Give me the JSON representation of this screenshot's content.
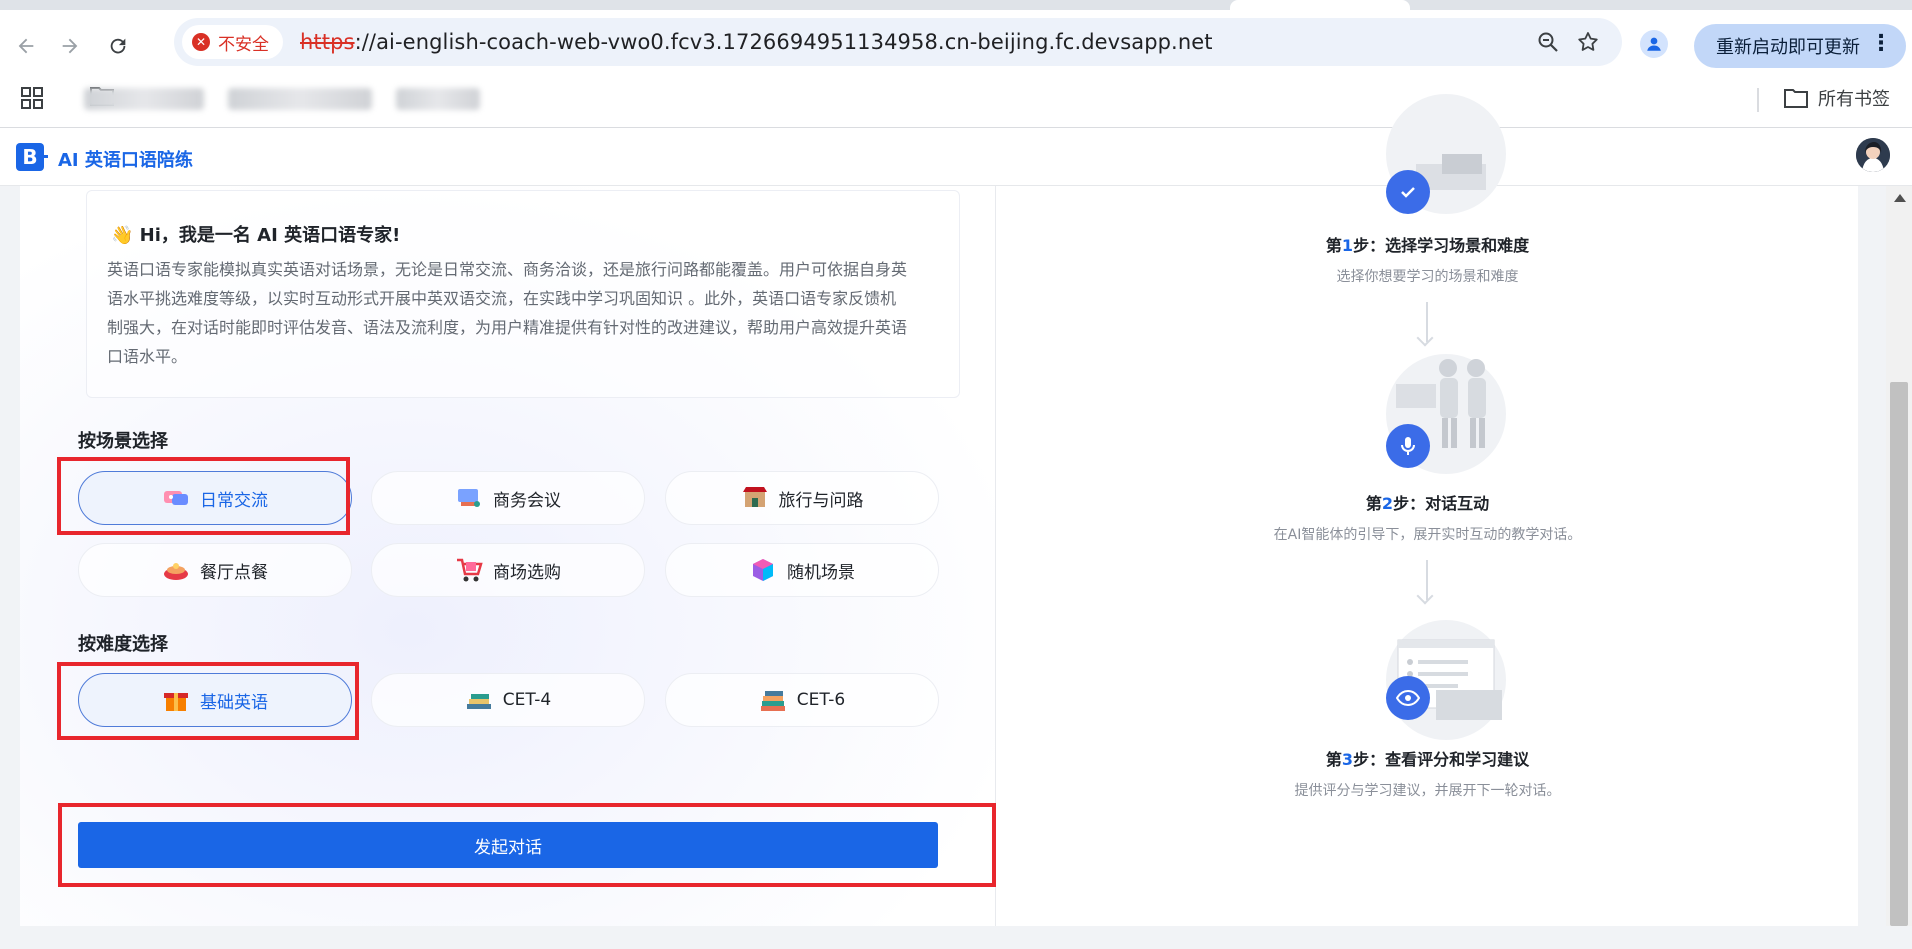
{
  "browser": {
    "security_label": "不安全",
    "url_scheme": "https",
    "url_rest": "://ai-english-coach-web-vwo0.fcv3.1726694951134958.cn-beijing.fc.devsapp.net",
    "update_button": "重新启动即可更新",
    "menu_dots": "⋮",
    "all_bookmarks": "所有书签"
  },
  "site": {
    "logo_letter": "B",
    "title": "AI 英语口语陪练"
  },
  "intro": {
    "title": "👋 Hi，我是一名 AI 英语口语专家!",
    "body": "英语口语专家能模拟真实英语对话场景，无论是日常交流、商务洽谈，还是旅行问路都能覆盖。用户可依据自身英语水平挑选难度等级，以实时互动形式开展中英双语交流，在实践中学习巩固知识 。此外，英语口语专家反馈机制强大，在对话时能即时评估发音、语法及流利度，为用户精准提供有针对性的改进建议，帮助用户高效提升英语口语水平。"
  },
  "scene_section": {
    "label": "按场景选择",
    "options": [
      {
        "label": "日常交流",
        "icon": "daily-chat-icon",
        "selected": true
      },
      {
        "label": "商务会议",
        "icon": "business-meeting-icon",
        "selected": false
      },
      {
        "label": "旅行与问路",
        "icon": "travel-icon",
        "selected": false
      },
      {
        "label": "餐厅点餐",
        "icon": "restaurant-icon",
        "selected": false
      },
      {
        "label": "商场选购",
        "icon": "shopping-cart-icon",
        "selected": false
      },
      {
        "label": "随机场景",
        "icon": "random-dice-icon",
        "selected": false
      }
    ]
  },
  "difficulty_section": {
    "label": "按难度选择",
    "options": [
      {
        "label": "基础英语",
        "icon": "gift-box-icon",
        "selected": true
      },
      {
        "label": "CET-4",
        "icon": "books-icon",
        "selected": false
      },
      {
        "label": "CET-6",
        "icon": "book-stack-icon",
        "selected": false
      }
    ]
  },
  "start_button": "发起对话",
  "steps": [
    {
      "prefix": "第",
      "num": "1",
      "suffix": "步：选择学习场景和难度",
      "desc": "选择你想要学习的场景和难度"
    },
    {
      "prefix": "第",
      "num": "2",
      "suffix": "步：对话互动",
      "desc": "在AI智能体的引导下，展开实时互动的教学对话。"
    },
    {
      "prefix": "第",
      "num": "3",
      "suffix": "步：查看评分和学习建议",
      "desc": "提供评分与学习建议，并展开下一轮对话。"
    }
  ],
  "colors": {
    "accent": "#1a66e6",
    "highlight_box": "#e8262d",
    "insecure": "#d93025"
  }
}
